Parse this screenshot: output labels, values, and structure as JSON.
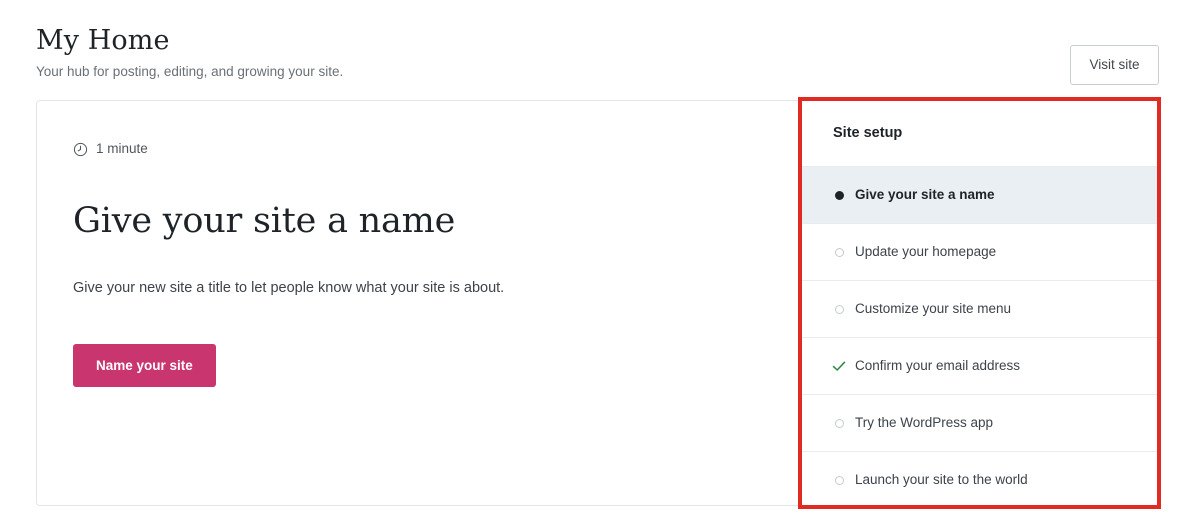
{
  "header": {
    "title": "My Home",
    "subtitle": "Your hub for posting, editing, and growing your site.",
    "visit_site_label": "Visit site"
  },
  "task": {
    "duration_icon": "clock-icon",
    "duration_label": "1 minute",
    "title": "Give your site a name",
    "description": "Give your new site a title to let people know what your site is about.",
    "cta_label": "Name your site"
  },
  "setup": {
    "panel_title": "Site setup",
    "items": [
      {
        "label": "Give your site a name",
        "state": "active",
        "marker": "dot-filled-icon"
      },
      {
        "label": "Update your homepage",
        "state": "pending",
        "marker": "circle-outline-icon"
      },
      {
        "label": "Customize your site menu",
        "state": "pending",
        "marker": "circle-outline-icon"
      },
      {
        "label": "Confirm your email address",
        "state": "complete",
        "marker": "check-icon"
      },
      {
        "label": "Try the WordPress app",
        "state": "pending",
        "marker": "circle-outline-icon"
      },
      {
        "label": "Launch your site to the world",
        "state": "pending",
        "marker": "circle-outline-icon"
      }
    ]
  },
  "colors": {
    "primary_button": "#c9356e",
    "annotation_border": "#e02a22",
    "active_row_background": "#e9eff3",
    "complete_check": "#2e8540"
  }
}
